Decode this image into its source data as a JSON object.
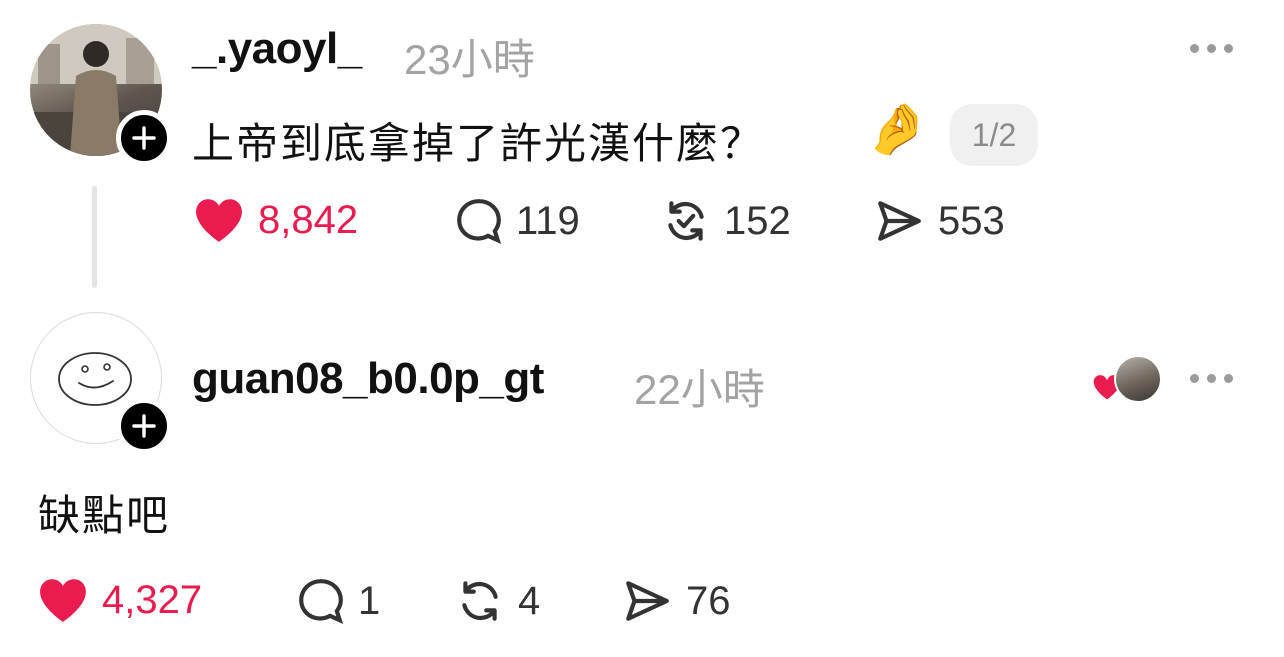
{
  "post": {
    "username": "_.yaoyl_",
    "time": "23小時",
    "text": "上帝到底拿掉了許光漢什麼？",
    "emoji": "🤌",
    "page_indicator": "1/2",
    "likes": "8,842",
    "comments": "119",
    "reposts": "152",
    "shares": "553"
  },
  "reply": {
    "username": "guan08_b0.0p_gt",
    "time": "22小時",
    "text": "缺點吧",
    "likes": "4,327",
    "comments": "1",
    "reposts": "4",
    "shares": "76"
  },
  "colors": {
    "like_red": "#ea1b4e",
    "muted_gray": "#a3a3a3"
  },
  "icons": [
    "heart-icon",
    "comment-icon",
    "repost-icon",
    "share-icon",
    "more-icon",
    "plus-icon"
  ]
}
